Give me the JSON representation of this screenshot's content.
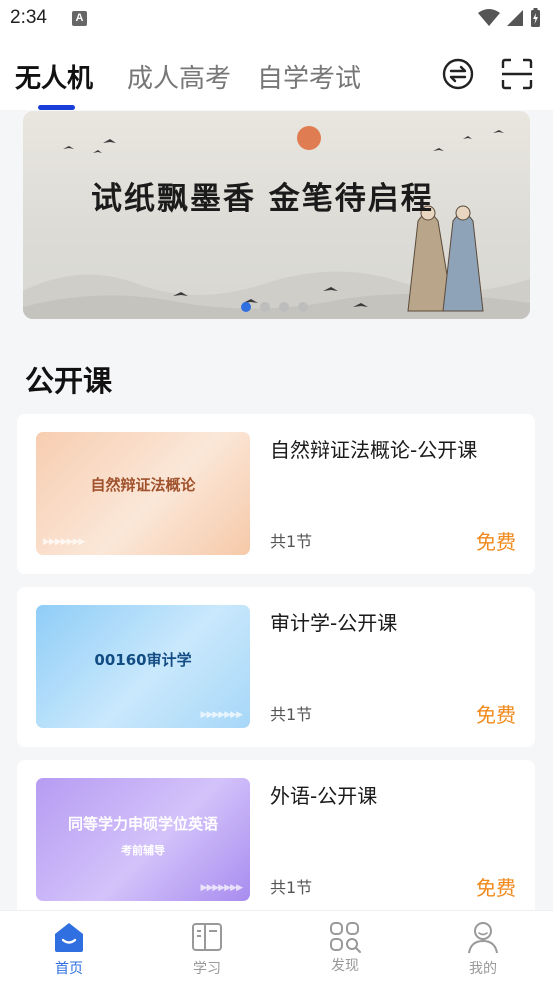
{
  "status_bar": {
    "time": "2:34",
    "notification_letter": "A"
  },
  "tabs": [
    {
      "label": "无人机",
      "active": true
    },
    {
      "label": "成人高考",
      "active": false
    },
    {
      "label": "自学考试",
      "active": false
    }
  ],
  "header_icons": [
    "switch-icon",
    "scan-icon"
  ],
  "banner": {
    "title": "试纸飘墨香 金笔待启程",
    "page_count": 4,
    "active_page": 1
  },
  "section": {
    "title": "公开课"
  },
  "courses": [
    {
      "title": "自然辩证法概论-公开课",
      "thumb_text": "自然辩证法概论",
      "thumb_sub": "",
      "lessons": "共1节",
      "price": "免费"
    },
    {
      "title": "审计学-公开课",
      "thumb_text": "00160审计学",
      "thumb_sub": "",
      "lessons": "共1节",
      "price": "免费"
    },
    {
      "title": "外语-公开课",
      "thumb_text": "同等学力申硕学位英语",
      "thumb_sub": "考前辅导",
      "lessons": "共1节",
      "price": "免费"
    }
  ],
  "colors": {
    "accent": "#2f6fe0",
    "tab_underline": "#1a3fd8",
    "price": "#f08a1c"
  },
  "bottom_nav": [
    {
      "label": "首页",
      "icon": "home-icon",
      "active": true
    },
    {
      "label": "学习",
      "icon": "book-icon",
      "active": false
    },
    {
      "label": "发现",
      "icon": "discover-icon",
      "active": false
    },
    {
      "label": "我的",
      "icon": "profile-icon",
      "active": false
    }
  ]
}
